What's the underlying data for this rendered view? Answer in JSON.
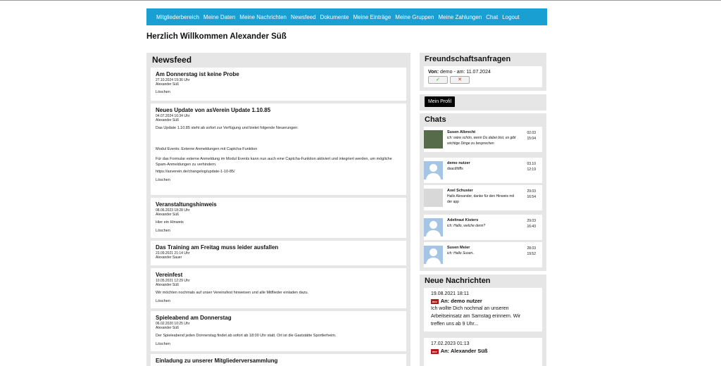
{
  "nav": [
    "Mitgliederbereich",
    "Meine Daten",
    "Meine Nachrichten",
    "Newsfeed",
    "Dokumente",
    "Meine Einträge",
    "Meine Gruppen",
    "Meine Zahlungen",
    "Chat",
    "Logout"
  ],
  "welcome": "Herzlich Willkommen Alexander Süß",
  "newsfeed": {
    "title": "Newsfeed",
    "posts": [
      {
        "title": "Am Donnerstag ist keine Probe",
        "date": "27.10.2024 19:36 Uhr",
        "author": "Alexander Süß",
        "body": [],
        "delete": "Löschen"
      },
      {
        "title": "Neues Update von asVerein Update 1.10.85",
        "date": "04.07.2024 16:34 Uhr",
        "author": "Alexander Süß",
        "body": [
          "Das Update 1.10.85 steht ab sofort zur Verfügung und bietet folgende Neuerungen:",
          "",
          "",
          "Modul Events: Externe Anmeldungen mit Captcha-Funktion",
          "",
          "Für das Formular externe Anmeldung im Modul Events kann nun auch eine Captcha-Funktion aktiviert und integriert werden, um mögliche Spam-Anmeldungen zu verhindern.",
          "https://asverein.de/changelog/update-1-10-85/"
        ],
        "delete": "Löschen"
      },
      {
        "title": "Veranstaltungshinweis",
        "date": "08.06.2023 18:28 Uhr",
        "author": "Alexander Süß",
        "body": [
          "Hier ein Hinweis"
        ],
        "delete": "Löschen"
      },
      {
        "title": "Das Training am Freitag muss leider ausfallen",
        "date": "23.09.2021 21:14 Uhr",
        "author": "Alexander Sauer",
        "body": [],
        "delete": ""
      },
      {
        "title": "Vereinfest",
        "date": "10.05.2021 12:29 Uhr",
        "author": "Alexander Süß",
        "body": [
          "Wir möchten nochmals auf unser Vereinsfest hinweisen und alle Mitflieder einladen dazu."
        ],
        "delete": "Löschen"
      },
      {
        "title": "Spieleabend am Donnerstag",
        "date": "06.02.2020 10:25 Uhr",
        "author": "Alexander Süß",
        "body": [
          "Der Spieleabend jeden Donnerstag findet ab sofort ab 18:00 Uhr statt. Ort ist die Gaststätte Sportlerheim."
        ],
        "delete": "Löschen"
      },
      {
        "title": "Einladung zu unserer Mitgliederversammlung",
        "date": "",
        "author": "",
        "body": [],
        "delete": ""
      }
    ]
  },
  "friends": {
    "title": "Freundschaftsanfragen",
    "from_label": "Von:",
    "from_text": "demo - am: 11.07.2024",
    "accept": "✓",
    "reject": "✕"
  },
  "profile_button": "Mein Profil",
  "chats": {
    "title": "Chats",
    "items": [
      {
        "name": "Susen Albrecht",
        "text": "ich: wäre schön, wenn Du dabei bist, es gibt wichtige Dinge zu besprechen",
        "date": "02.03",
        "time": "15:04",
        "italic": true,
        "avatar": "photo"
      },
      {
        "name": "demo nutzer",
        "text": "dsacdfdffs",
        "date": "03.10",
        "time": "12:19",
        "italic": false,
        "avatar": "default"
      },
      {
        "name": "Axel Schuster",
        "text": "Hallo Alexander, danke für den Hinweis mit der app",
        "date": "29.03",
        "time": "16:54",
        "italic": false,
        "avatar": "photo2"
      },
      {
        "name": "Adeltraut Kisters",
        "text": "ich: Hallo, welche denn?",
        "date": "29.03",
        "time": "16:43",
        "italic": true,
        "avatar": "default"
      },
      {
        "name": "Susen Meier",
        "text": "ich: Hallo Susen..",
        "date": "28.03",
        "time": "19:52",
        "italic": true,
        "avatar": "default"
      }
    ]
  },
  "messages": {
    "title": "Neue Nachrichten",
    "items": [
      {
        "date": "19.08.2021 18:11",
        "badge": "asv",
        "to": "An: demo nutzer",
        "text": "Ich wollte Dich nochmal an unseren Arbeitseinsatz am Samstag erinnern. Wir treffen uns ab 9 Uhr..."
      },
      {
        "date": "17.02.2023 01:13",
        "badge": "asv",
        "to": "An: Alexander Süß",
        "text": ""
      }
    ]
  }
}
